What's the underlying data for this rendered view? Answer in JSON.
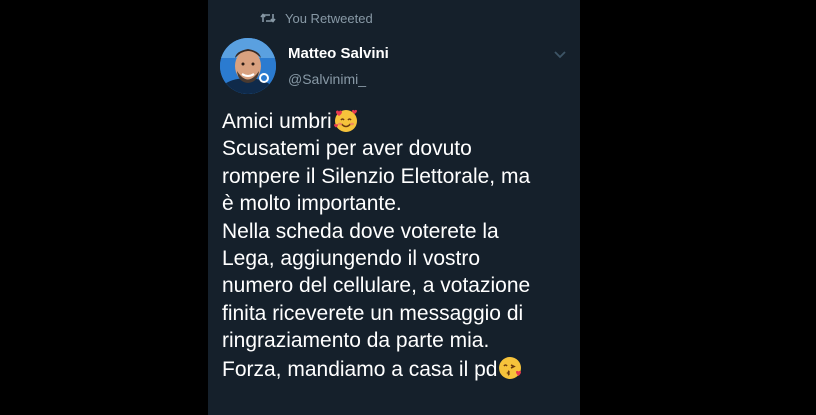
{
  "retweet": {
    "icon": "retweet-icon",
    "label": "You Retweeted"
  },
  "author": {
    "name": "Matteo Salvini",
    "handle": "@Salvinimi_",
    "avatar": "avatar-photo"
  },
  "menu": {
    "icon": "chevron-down-icon"
  },
  "tweet": {
    "lines": [
      "Amici umbri",
      "Scusatemi per aver dovuto",
      "rompere il Silenzio Elettorale, ma",
      "è molto importante.",
      "Nella scheda dove voterete la",
      "Lega, aggiungendo il vostro",
      "numero del cellulare, a votazione",
      "finita riceverete un messaggio di",
      "ringraziamento da parte mia.",
      "Forza, mandiamo a casa il pd"
    ],
    "emoji": {
      "first": "smiling-face-with-hearts-emoji",
      "last": "face-blowing-kiss-emoji"
    }
  },
  "colors": {
    "background": "#15202b",
    "text": "#ffffff",
    "secondary": "#8899a6",
    "page": "#000000"
  }
}
